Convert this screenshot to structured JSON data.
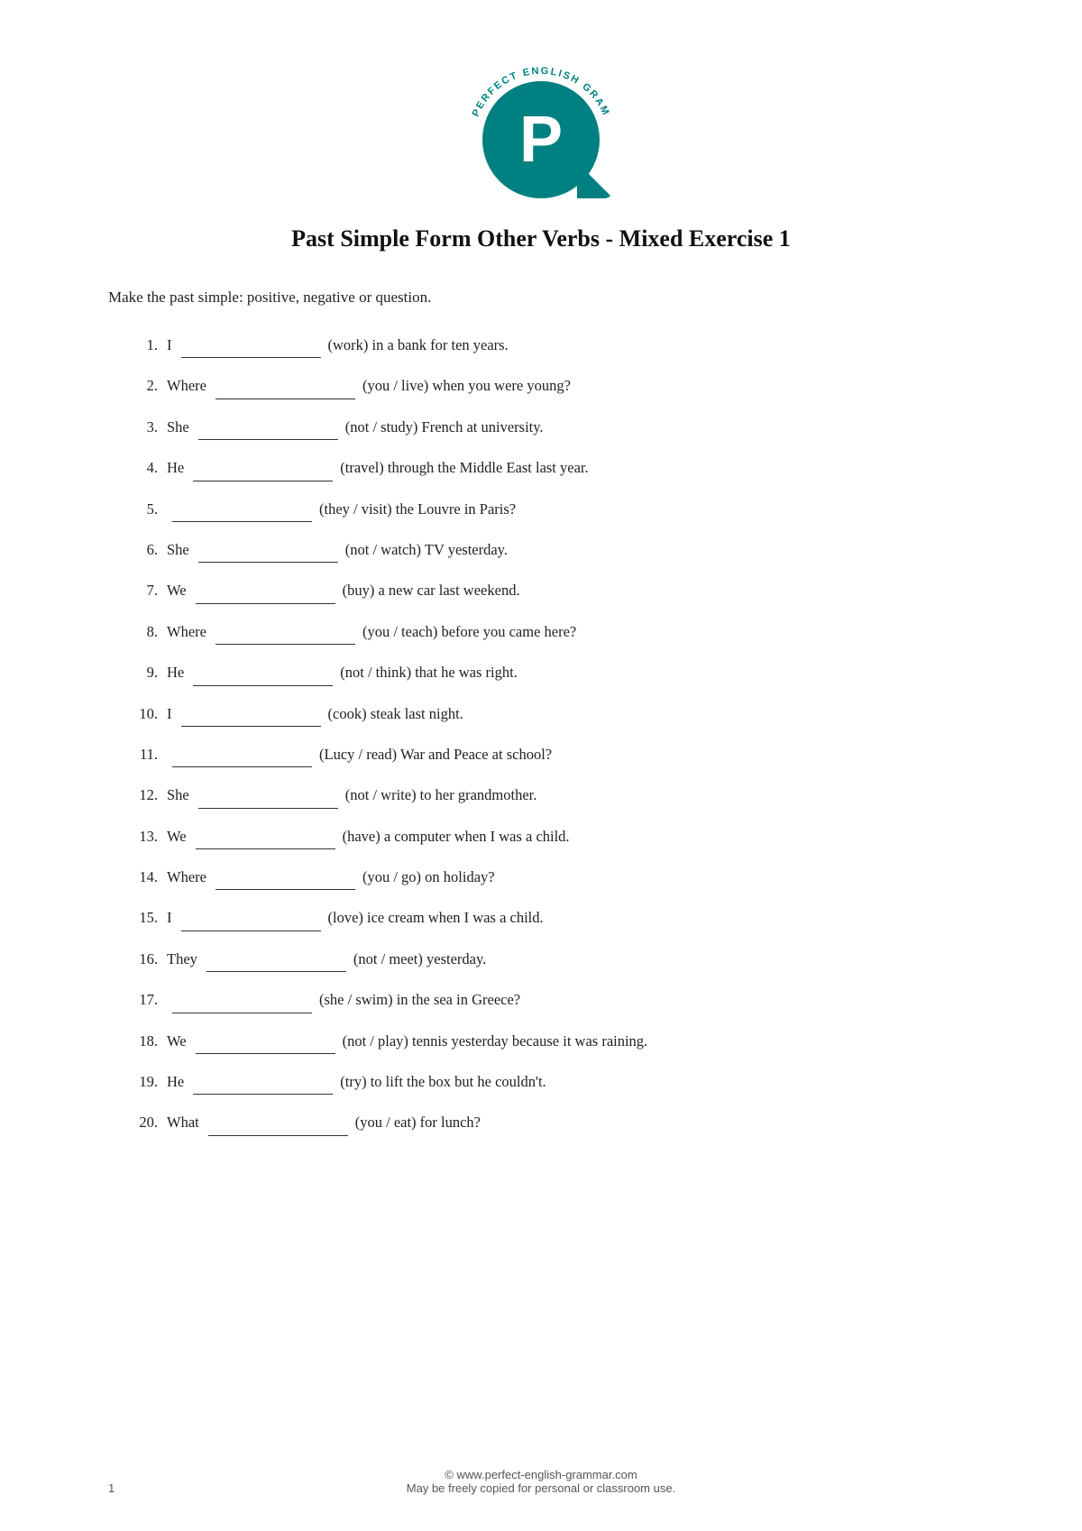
{
  "logo": {
    "letter": "P",
    "arc_top": "ENGLISH GRAMMAR",
    "arc_bottom": "PERFECT"
  },
  "title": "Past Simple Form Other Verbs - Mixed Exercise 1",
  "instructions": "Make the past simple: positive, negative or question.",
  "exercises": [
    {
      "number": "1.",
      "subject": "I",
      "blank": true,
      "rest": "(work) in a bank for ten years."
    },
    {
      "number": "2.",
      "subject": "Where",
      "blank": true,
      "rest": "(you / live) when you were young?"
    },
    {
      "number": "3.",
      "subject": "She",
      "blank": true,
      "rest": "(not / study) French at university."
    },
    {
      "number": "4.",
      "subject": "He",
      "blank": true,
      "rest": "(travel) through the Middle East last year."
    },
    {
      "number": "5.",
      "subject": "",
      "blank": true,
      "rest": "(they / visit) the Louvre in Paris?"
    },
    {
      "number": "6.",
      "subject": "She",
      "blank": true,
      "rest": "(not / watch) TV yesterday."
    },
    {
      "number": "7.",
      "subject": "We",
      "blank": true,
      "rest": "(buy) a new car last weekend."
    },
    {
      "number": "8.",
      "subject": "Where",
      "blank": true,
      "rest": "(you / teach) before you came here?"
    },
    {
      "number": "9.",
      "subject": "He",
      "blank": true,
      "rest": "(not / think) that he was right."
    },
    {
      "number": "10.",
      "subject": "I",
      "blank": true,
      "rest": "(cook) steak last night."
    },
    {
      "number": "11.",
      "subject": "",
      "blank": true,
      "rest": "(Lucy / read) War and Peace at school?"
    },
    {
      "number": "12.",
      "subject": "She",
      "blank": true,
      "rest": "(not / write) to her grandmother."
    },
    {
      "number": "13.",
      "subject": "We",
      "blank": true,
      "rest": "(have) a computer when I was a child."
    },
    {
      "number": "14.",
      "subject": "Where",
      "blank": true,
      "rest": "(you / go) on holiday?"
    },
    {
      "number": "15.",
      "subject": "I",
      "blank": true,
      "rest": "(love) ice cream when I was a child."
    },
    {
      "number": "16.",
      "subject": "They",
      "blank": true,
      "rest": "(not / meet) yesterday."
    },
    {
      "number": "17.",
      "subject": "",
      "blank": true,
      "rest": "(she / swim) in the sea in Greece?"
    },
    {
      "number": "18.",
      "subject": "We",
      "blank": true,
      "rest": "(not / play) tennis yesterday because it was raining."
    },
    {
      "number": "19.",
      "subject": "He",
      "blank": true,
      "rest": "(try) to lift the box but he couldn't."
    },
    {
      "number": "20.",
      "subject": "What",
      "blank": true,
      "rest": "(you / eat) for lunch?"
    }
  ],
  "footer": {
    "page_number": "1",
    "copyright": "© www.perfect-english-grammar.com",
    "usage": "May be freely copied for personal or classroom use."
  }
}
